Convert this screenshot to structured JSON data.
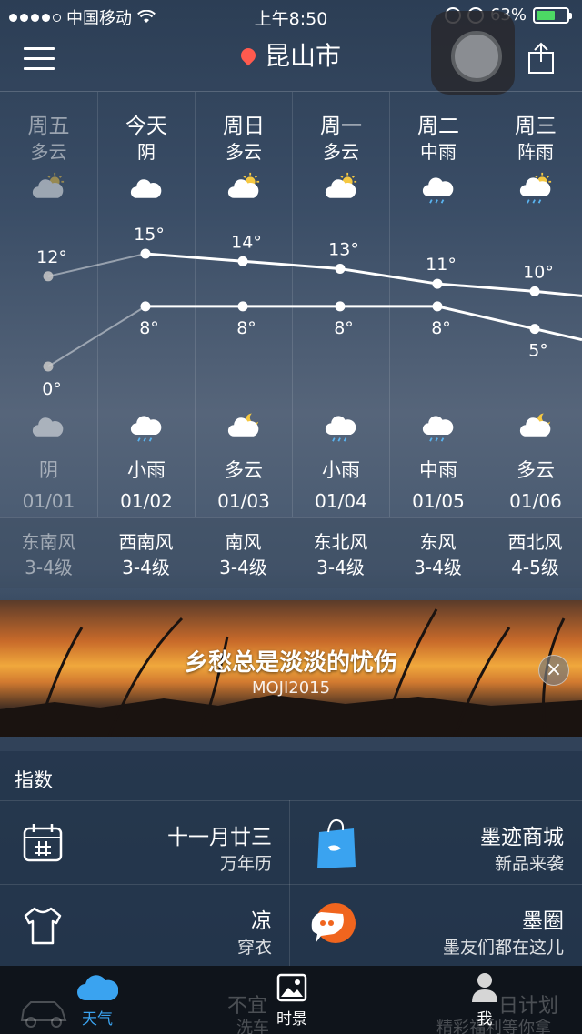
{
  "status_bar": {
    "carrier": "中国移动",
    "time": "上午8:50",
    "battery": "63%",
    "battery_level": 0.63
  },
  "header": {
    "city": "昆山市"
  },
  "forecast": [
    {
      "day": "周五",
      "condition": "多云",
      "night_condition": "阴",
      "date": "01/01",
      "high": 12,
      "low": 0,
      "high_label": "12°",
      "low_label": "0°",
      "icon_day": "partly-cloudy-icon",
      "icon_night": "cloudy-icon",
      "wind_dir": "东南风",
      "wind_level": "3-4级"
    },
    {
      "day": "今天",
      "condition": "阴",
      "night_condition": "小雨",
      "date": "01/02",
      "high": 15,
      "low": 8,
      "high_label": "15°",
      "low_label": "8°",
      "icon_day": "cloudy-icon",
      "icon_night": "light-rain-icon",
      "wind_dir": "西南风",
      "wind_level": "3-4级"
    },
    {
      "day": "周日",
      "condition": "多云",
      "night_condition": "多云",
      "date": "01/03",
      "high": 14,
      "low": 8,
      "high_label": "14°",
      "low_label": "8°",
      "icon_day": "partly-cloudy-icon",
      "icon_night": "partly-cloudy-night-icon",
      "wind_dir": "南风",
      "wind_level": "3-4级"
    },
    {
      "day": "周一",
      "condition": "多云",
      "night_condition": "小雨",
      "date": "01/04",
      "high": 13,
      "low": 8,
      "high_label": "13°",
      "low_label": "8°",
      "icon_day": "partly-cloudy-icon",
      "icon_night": "light-rain-icon",
      "wind_dir": "东北风",
      "wind_level": "3-4级"
    },
    {
      "day": "周二",
      "condition": "中雨",
      "night_condition": "中雨",
      "date": "01/05",
      "high": 11,
      "low": 8,
      "high_label": "11°",
      "low_label": "8°",
      "icon_day": "moderate-rain-icon",
      "icon_night": "moderate-rain-icon",
      "wind_dir": "东风",
      "wind_level": "3-4级"
    },
    {
      "day": "周三",
      "condition": "阵雨",
      "night_condition": "多云",
      "date": "01/06",
      "high": 10,
      "low": 5,
      "high_label": "10°",
      "low_label": "5°",
      "icon_day": "shower-icon",
      "icon_night": "partly-cloudy-night-icon",
      "wind_dir": "西北风",
      "wind_level": "4-5级"
    }
  ],
  "banner": {
    "title": "乡愁总是淡淡的忧伤",
    "subtitle": "MOJI2015",
    "close": "×"
  },
  "index": {
    "title": "指数",
    "tiles": [
      {
        "title": "十一月廿三",
        "subtitle": "万年历",
        "icon": "calendar-icon"
      },
      {
        "title": "墨迹商城",
        "subtitle": "新品来袭",
        "icon": "shopping-bag-icon"
      },
      {
        "title": "凉",
        "subtitle": "穿衣",
        "icon": "shirt-icon"
      },
      {
        "title": "墨圈",
        "subtitle": "墨友们都在这儿",
        "icon": "chat-bubble-icon"
      }
    ]
  },
  "tabbar": {
    "tabs": [
      {
        "label": "天气",
        "icon": "cloud-icon",
        "active": true
      },
      {
        "label": "时景",
        "icon": "photo-icon",
        "active": false
      },
      {
        "label": "我",
        "icon": "person-icon",
        "active": false
      }
    ],
    "ghost_left": [
      "不宜",
      "洗车"
    ],
    "ghost_right": [
      "日计划",
      "精彩福利等你拿"
    ]
  },
  "colors": {
    "accent": "#3aa3f0",
    "pin": "#ff5a4e",
    "battery": "#4cd964"
  }
}
